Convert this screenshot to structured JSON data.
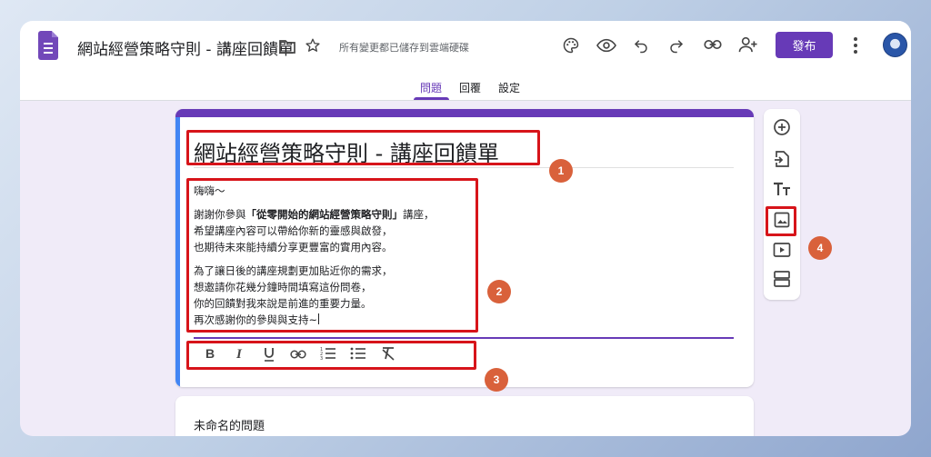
{
  "header": {
    "doc_title": "網站經營策略守則 - 講座回饋單",
    "save_status": "所有變更都已儲存到雲端硬碟",
    "publish_label": "發布"
  },
  "tabs": [
    {
      "label": "問題",
      "active": true
    },
    {
      "label": "回覆",
      "active": false
    },
    {
      "label": "設定",
      "active": false
    }
  ],
  "form": {
    "title": "網站經營策略守則 - 講座回饋單",
    "description": {
      "greeting": "嗨嗨～",
      "p1_prefix": "謝謝你參與",
      "p1_bold": "「從零開始的網站經營策略守則」",
      "p1_suffix": "講座，",
      "p1_line2": "希望講座內容可以帶給你新的靈感與啟發，",
      "p1_line3": "也期待未來能持續分享更豐富的實用內容。",
      "p2_line1": "為了讓日後的講座規劃更加貼近你的需求，",
      "p2_line2": "想邀請你花幾分鐘時間填寫這份問卷，",
      "p2_line3": "你的回饋對我來說是前進的重要力量。",
      "p2_line4": "再次感謝你的參與與支持~"
    }
  },
  "question": {
    "title": "未命名的問題"
  },
  "annotations": [
    "1",
    "2",
    "3",
    "4"
  ],
  "colors": {
    "accent": "#673ab7",
    "stripe": "#4285f4",
    "highlight": "#d7141a",
    "badge": "#d9613b",
    "background": "#f0ebf8"
  },
  "icons": {
    "toolbar": [
      "palette-icon",
      "preview-icon",
      "undo-icon",
      "redo-icon",
      "link-icon",
      "add-collaborator-icon",
      "more-vert-icon"
    ],
    "format": [
      "bold-icon",
      "italic-icon",
      "underline-icon",
      "link-icon",
      "numbered-list-icon",
      "bulleted-list-icon",
      "clear-format-icon"
    ],
    "sidebar": [
      "add-question-icon",
      "import-questions-icon",
      "add-title-icon",
      "add-image-icon",
      "add-video-icon",
      "add-section-icon"
    ]
  }
}
